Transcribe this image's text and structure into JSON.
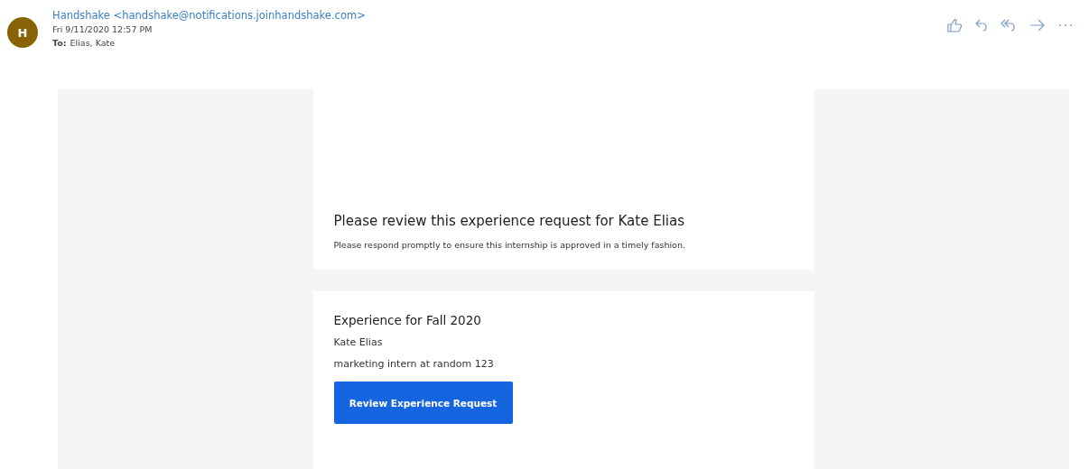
{
  "message": {
    "avatar_initial": "H",
    "sender": "Handshake <handshake@notifications.joinhandshake.com>",
    "date": "Fri 9/11/2020 12:57 PM",
    "to_label": "To:",
    "to": "Elias, Kate"
  },
  "body": {
    "intro": {
      "heading": "Please review this experience request for Kate Elias",
      "text": "Please respond promptly to ensure this internship is approved in a timely fashion."
    },
    "experience": {
      "heading": "Experience for Fall 2020",
      "name": "Kate Elias",
      "role": "marketing intern at random 123",
      "button": "Review Experience Request"
    }
  }
}
